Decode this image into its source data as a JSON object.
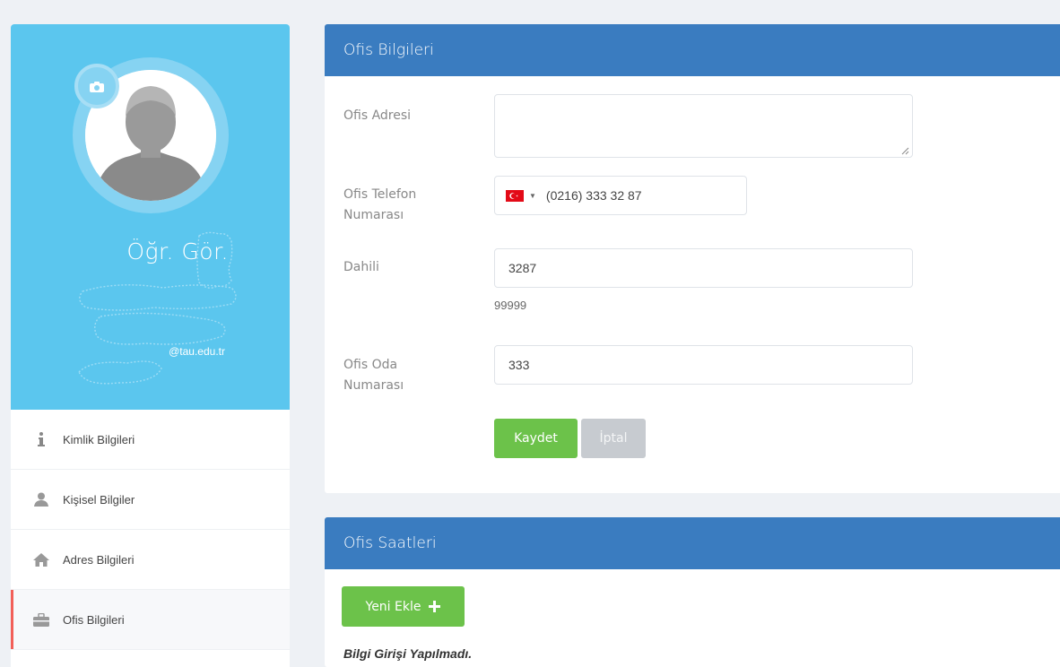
{
  "sidebar": {
    "profile": {
      "title": "Öğr. Gör.",
      "email": "@tau.edu.tr"
    },
    "items": [
      {
        "label": "Kimlik Bilgileri",
        "icon": "info-icon"
      },
      {
        "label": "Kişisel Bilgiler",
        "icon": "user-icon"
      },
      {
        "label": "Adres Bilgileri",
        "icon": "home-icon"
      },
      {
        "label": "Ofis Bilgileri",
        "icon": "briefcase-icon",
        "active": true
      }
    ]
  },
  "office_panel": {
    "title": "Ofis Bilgileri",
    "address_label": "Ofis Adresi",
    "address_value": "",
    "phone_label_line1": "Ofis Telefon",
    "phone_label_line2": "Numarası",
    "phone_country": "TR",
    "phone_value": "(0216) 333 32 87",
    "extension_label": "Dahili",
    "extension_value": "3287",
    "extension_hint": "99999",
    "room_label_line1": "Ofis Oda",
    "room_label_line2": "Numarası",
    "room_value": "333",
    "save_label": "Kaydet",
    "cancel_label": "İptal"
  },
  "hours_panel": {
    "title": "Ofis Saatleri",
    "add_label": "Yeni Ekle",
    "empty_message": "Bilgi Girişi Yapılmadı."
  },
  "colors": {
    "profile_bg": "#5bc6ee",
    "panel_header": "#3a7cc0",
    "success": "#6cc24a",
    "active_marker": "#f25f58"
  }
}
